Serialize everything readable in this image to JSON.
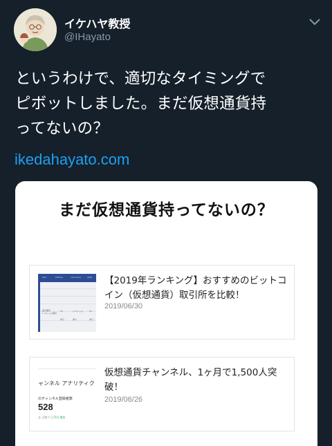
{
  "user": {
    "display_name": "イケハヤ教授",
    "handle": "@IHayato"
  },
  "tweet": {
    "lines": [
      "というわけで、適切なタイミングで",
      "ピボットしました。まだ仮想通貨持",
      "ってないの？"
    ],
    "link": "ikedahayato.com"
  },
  "card": {
    "title": "まだ仮想通貨持ってないの？",
    "articles": [
      {
        "title": "【2019年ランキング】おすすめのビットコイン（仮想通貨）取引所を比較！",
        "date": "2019/06/30",
        "thumb": {
          "headers": [
            "Zaif",
            "bitFlyer",
            "coincheck",
            "GMO"
          ],
          "row_left": [
            "最大取引",
            "レバレッジ取引"
          ],
          "cells": [
            "FX",
            "レバレッジ",
            "FX",
            "あり",
            "あり",
            "あり"
          ]
        }
      },
      {
        "title": "仮想通貨チャンネル、1ヶ月で1,500人突破！",
        "date": "2019/06/26",
        "thumb": {
          "heading": "ャンネル アナリティク",
          "label": "のチャンネル登録者数",
          "number": "528",
          "sub_prefix": "去 日間で",
          "sub_value": "1,054 増加"
        }
      }
    ]
  },
  "colors": {
    "background": "#15202b",
    "link": "#1da1f2",
    "secondary_text": "#8899a6",
    "thumb_blue": "#2c4c94"
  }
}
